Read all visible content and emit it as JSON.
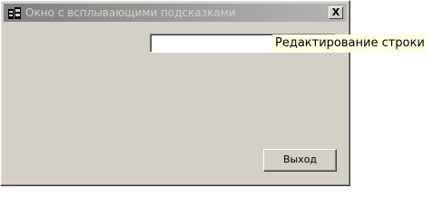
{
  "window": {
    "title": "Окно с всплывающими подсказками",
    "icon": "app-window-icon",
    "close_label": "X"
  },
  "input": {
    "value": ""
  },
  "tooltip": {
    "text": "Редактирование строки"
  },
  "buttons": {
    "exit_label": "Выход"
  },
  "colors": {
    "face": "#d4d0c8",
    "titlebar_start": "#808080",
    "titlebar_end": "#b5b5b5",
    "tooltip_bg": "#ffffe1"
  }
}
